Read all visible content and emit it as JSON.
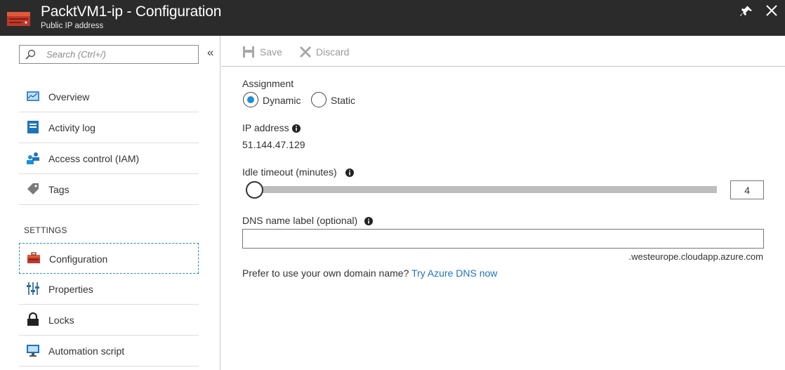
{
  "header": {
    "title": "PacktVM1-ip - Configuration",
    "subtitle": "Public IP address",
    "resource_icon": "public-ip-address-icon",
    "pin_icon": "pin-icon",
    "close_icon": "close-icon"
  },
  "sidebar": {
    "search_placeholder": "Search (Ctrl+/)",
    "collapse_label": "«",
    "items": [
      {
        "label": "Overview",
        "icon": "overview-icon"
      },
      {
        "label": "Activity log",
        "icon": "activity-log-icon"
      },
      {
        "label": "Access control (IAM)",
        "icon": "access-control-icon"
      },
      {
        "label": "Tags",
        "icon": "tag-icon"
      }
    ],
    "section_settings": "SETTINGS",
    "settings_items": [
      {
        "label": "Configuration",
        "icon": "configuration-icon",
        "active": true
      },
      {
        "label": "Properties",
        "icon": "properties-icon"
      },
      {
        "label": "Locks",
        "icon": "lock-icon"
      },
      {
        "label": "Automation script",
        "icon": "automation-script-icon"
      }
    ]
  },
  "toolbar": {
    "save_label": "Save",
    "discard_label": "Discard"
  },
  "form": {
    "assignment_label": "Assignment",
    "assignment_options": [
      "Dynamic",
      "Static"
    ],
    "assignment_selected": "Dynamic",
    "ip_label": "IP address",
    "ip_value": "51.144.47.129",
    "idle_label": "Idle timeout (minutes)",
    "idle_value": "4",
    "dns_label": "DNS name label (optional)",
    "dns_value": "",
    "dns_suffix": ".westeurope.cloudapp.azure.com",
    "prefer_text": "Prefer to use your own domain name?",
    "prefer_link": "Try Azure DNS now"
  },
  "colors": {
    "header_bg": "#2b2b2b",
    "accent": "#1e8fd6",
    "link": "#1e73be"
  }
}
